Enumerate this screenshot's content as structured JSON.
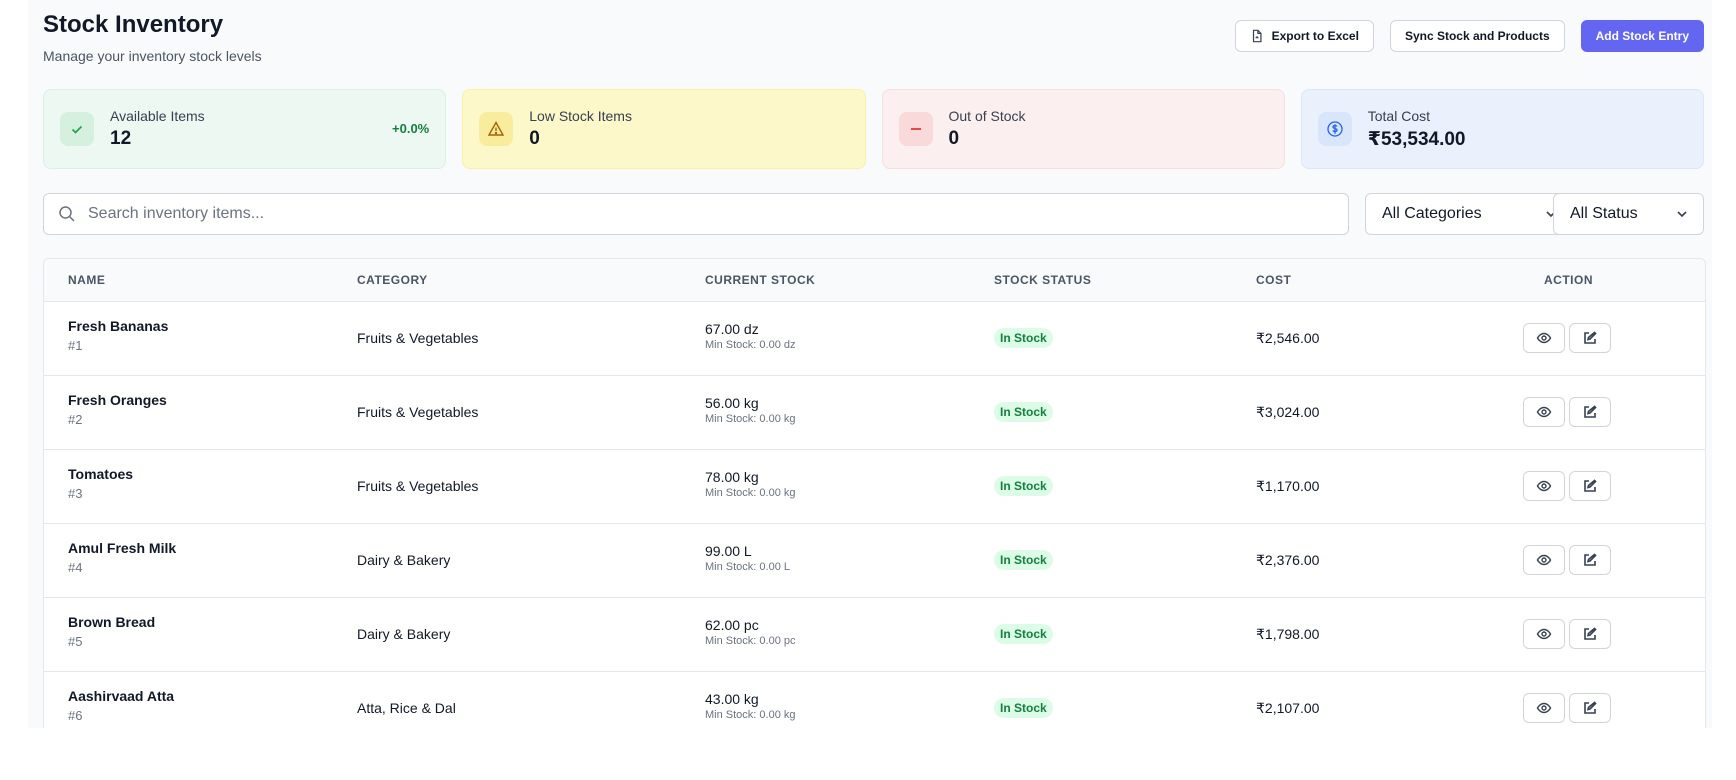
{
  "header": {
    "title": "Stock Inventory",
    "subtitle": "Manage your inventory stock levels",
    "export_label": "Export to Excel",
    "sync_label": "Sync Stock and Products",
    "add_label": "Add Stock Entry"
  },
  "cards": [
    {
      "label": "Available Items",
      "value": "12",
      "change": "+0.0%",
      "icon": "check-icon"
    },
    {
      "label": "Low Stock Items",
      "value": "0",
      "icon": "warning-icon"
    },
    {
      "label": "Out of Stock",
      "value": "0",
      "icon": "minus-icon"
    },
    {
      "label": "Total Cost",
      "value": "₹53,534.00",
      "icon": "dollar-circle-icon"
    }
  ],
  "search": {
    "placeholder": "Search inventory items..."
  },
  "filters": {
    "category": "All Categories",
    "status": "All Status"
  },
  "table": {
    "columns": [
      "NAME",
      "CATEGORY",
      "CURRENT STOCK",
      "STOCK STATUS",
      "COST",
      "ACTION"
    ],
    "rows": [
      {
        "name": "Fresh Bananas",
        "id": "#1",
        "category": "Fruits & Vegetables",
        "stock": "67.00 dz",
        "min": "Min Stock: 0.00 dz",
        "status": "In Stock",
        "cost": "₹2,546.00"
      },
      {
        "name": "Fresh Oranges",
        "id": "#2",
        "category": "Fruits & Vegetables",
        "stock": "56.00 kg",
        "min": "Min Stock: 0.00 kg",
        "status": "In Stock",
        "cost": "₹3,024.00"
      },
      {
        "name": "Tomatoes",
        "id": "#3",
        "category": "Fruits & Vegetables",
        "stock": "78.00 kg",
        "min": "Min Stock: 0.00 kg",
        "status": "In Stock",
        "cost": "₹1,170.00"
      },
      {
        "name": "Amul Fresh Milk",
        "id": "#4",
        "category": "Dairy & Bakery",
        "stock": "99.00 L",
        "min": "Min Stock: 0.00 L",
        "status": "In Stock",
        "cost": "₹2,376.00"
      },
      {
        "name": "Brown Bread",
        "id": "#5",
        "category": "Dairy & Bakery",
        "stock": "62.00 pc",
        "min": "Min Stock: 0.00 pc",
        "status": "In Stock",
        "cost": "₹1,798.00"
      },
      {
        "name": "Aashirvaad Atta",
        "id": "#6",
        "category": "Atta, Rice & Dal",
        "stock": "43.00 kg",
        "min": "Min Stock: 0.00 kg",
        "status": "In Stock",
        "cost": "₹2,107.00"
      }
    ]
  }
}
